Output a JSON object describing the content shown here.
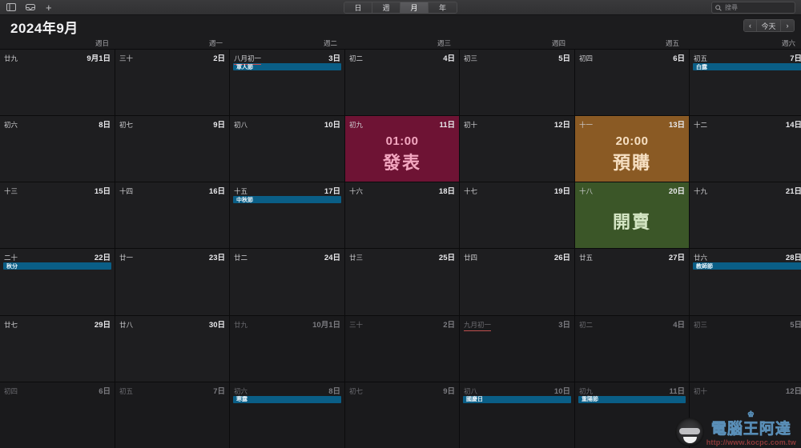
{
  "toolbar": {
    "icons": [
      {
        "name": "sidebar-toggle-icon",
        "glyph": "sidebar"
      },
      {
        "name": "inbox-icon",
        "glyph": "inbox"
      }
    ],
    "add_label": "+",
    "view_segments": [
      {
        "label": "日",
        "active": false
      },
      {
        "label": "週",
        "active": false
      },
      {
        "label": "月",
        "active": true
      },
      {
        "label": "年",
        "active": false
      }
    ],
    "search_placeholder": "搜尋"
  },
  "header": {
    "month_title": "2024年9月",
    "nav": {
      "prev_label": "‹",
      "today_label": "今天",
      "next_label": "›"
    }
  },
  "weekdays": [
    "週日",
    "週一",
    "週二",
    "週三",
    "週四",
    "週五",
    "週六"
  ],
  "colors": {
    "event_blue": "#0a5e86",
    "crimson": "#6e1334",
    "crimson_text": "#f3a7c0",
    "brown": "#8a5a24",
    "brown_text": "#f6dfc2",
    "green": "#3b5628",
    "green_text": "#d4e6c4",
    "today_underline": "#d24b4b"
  },
  "grid": [
    [
      {
        "lunar": "廿九",
        "day": "9月1日",
        "dim": false,
        "events": []
      },
      {
        "lunar": "三十",
        "day": "2日",
        "dim": false,
        "events": []
      },
      {
        "lunar": "八月初一",
        "day": "3日",
        "dim": false,
        "underline": true,
        "events": [
          {
            "label": "軍人節"
          }
        ]
      },
      {
        "lunar": "初二",
        "day": "4日",
        "dim": false,
        "events": []
      },
      {
        "lunar": "初三",
        "day": "5日",
        "dim": false,
        "events": []
      },
      {
        "lunar": "初四",
        "day": "6日",
        "dim": false,
        "events": []
      },
      {
        "lunar": "初五",
        "day": "7日",
        "dim": false,
        "events": [
          {
            "label": "白露"
          }
        ]
      }
    ],
    [
      {
        "lunar": "初六",
        "day": "8日",
        "dim": false,
        "events": []
      },
      {
        "lunar": "初七",
        "day": "9日",
        "dim": false,
        "events": []
      },
      {
        "lunar": "初八",
        "day": "10日",
        "dim": false,
        "events": []
      },
      {
        "lunar": "初九",
        "day": "11日",
        "dim": false,
        "tint": "crimson",
        "big": {
          "time": "01:00",
          "name": "發表"
        },
        "events": []
      },
      {
        "lunar": "初十",
        "day": "12日",
        "dim": false,
        "events": []
      },
      {
        "lunar": "十一",
        "day": "13日",
        "dim": false,
        "tint": "brown",
        "big": {
          "time": "20:00",
          "name": "預購"
        },
        "events": []
      },
      {
        "lunar": "十二",
        "day": "14日",
        "dim": false,
        "events": []
      }
    ],
    [
      {
        "lunar": "十三",
        "day": "15日",
        "dim": false,
        "events": []
      },
      {
        "lunar": "十四",
        "day": "16日",
        "dim": false,
        "events": []
      },
      {
        "lunar": "十五",
        "day": "17日",
        "dim": false,
        "events": [
          {
            "label": "中秋節"
          }
        ]
      },
      {
        "lunar": "十六",
        "day": "18日",
        "dim": false,
        "events": []
      },
      {
        "lunar": "十七",
        "day": "19日",
        "dim": false,
        "events": []
      },
      {
        "lunar": "十八",
        "day": "20日",
        "dim": false,
        "tint": "green",
        "big": {
          "time": "",
          "name": "開賣"
        },
        "events": []
      },
      {
        "lunar": "十九",
        "day": "21日",
        "dim": false,
        "events": []
      }
    ],
    [
      {
        "lunar": "二十",
        "day": "22日",
        "dim": false,
        "events": [
          {
            "label": "秋分"
          }
        ]
      },
      {
        "lunar": "廿一",
        "day": "23日",
        "dim": false,
        "events": []
      },
      {
        "lunar": "廿二",
        "day": "24日",
        "dim": false,
        "events": []
      },
      {
        "lunar": "廿三",
        "day": "25日",
        "dim": false,
        "events": []
      },
      {
        "lunar": "廿四",
        "day": "26日",
        "dim": false,
        "events": []
      },
      {
        "lunar": "廿五",
        "day": "27日",
        "dim": false,
        "events": []
      },
      {
        "lunar": "廿六",
        "day": "28日",
        "dim": false,
        "events": [
          {
            "label": "教師節"
          }
        ]
      }
    ],
    [
      {
        "lunar": "廿七",
        "day": "29日",
        "dim": false,
        "events": []
      },
      {
        "lunar": "廿八",
        "day": "30日",
        "dim": false,
        "events": []
      },
      {
        "lunar": "廿九",
        "day": "10月1日",
        "dim": true,
        "events": []
      },
      {
        "lunar": "三十",
        "day": "2日",
        "dim": true,
        "events": []
      },
      {
        "lunar": "九月初一",
        "day": "3日",
        "dim": true,
        "underline": true,
        "events": []
      },
      {
        "lunar": "初二",
        "day": "4日",
        "dim": true,
        "events": []
      },
      {
        "lunar": "初三",
        "day": "5日",
        "dim": true,
        "events": []
      }
    ],
    [
      {
        "lunar": "初四",
        "day": "6日",
        "dim": true,
        "events": []
      },
      {
        "lunar": "初五",
        "day": "7日",
        "dim": true,
        "events": []
      },
      {
        "lunar": "初六",
        "day": "8日",
        "dim": true,
        "events": [
          {
            "label": "寒露"
          }
        ]
      },
      {
        "lunar": "初七",
        "day": "9日",
        "dim": true,
        "events": []
      },
      {
        "lunar": "初八",
        "day": "10日",
        "dim": true,
        "events": [
          {
            "label": "國慶日"
          }
        ]
      },
      {
        "lunar": "初九",
        "day": "11日",
        "dim": true,
        "events": [
          {
            "label": "重陽節"
          }
        ]
      },
      {
        "lunar": "初十",
        "day": "12日",
        "dim": true,
        "events": []
      }
    ]
  ],
  "watermark": {
    "brand": "電腦王阿達",
    "url": "http://www.kocpc.com.tw"
  }
}
